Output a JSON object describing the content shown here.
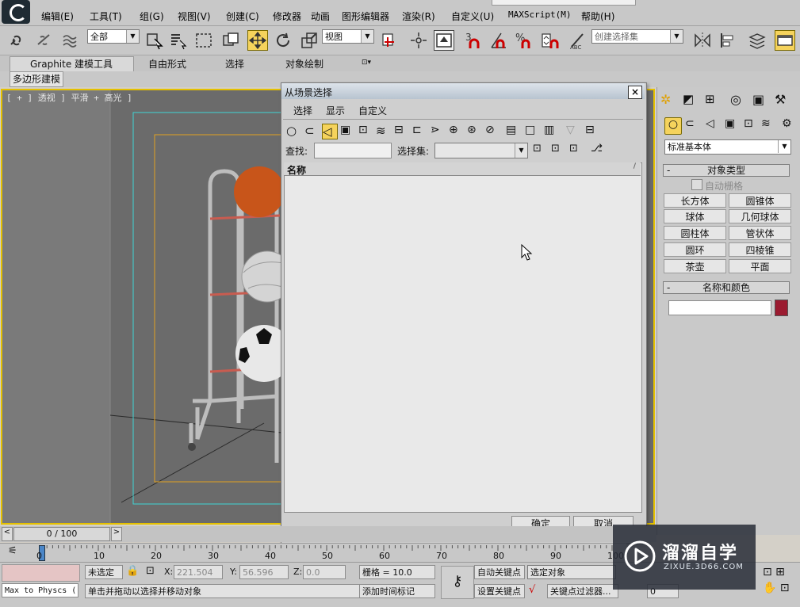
{
  "menu": {
    "items": [
      "编辑(E)",
      "工具(T)",
      "组(G)",
      "视图(V)",
      "创建(C)",
      "修改器",
      "动画",
      "图形编辑器",
      "渲染(R)",
      "自定义(U)",
      "MAXScript(M)",
      "帮助(H)"
    ]
  },
  "toolbar": {
    "filter_value": "全部",
    "refcoord_value": "视图",
    "snap_labels": [
      "3",
      "%"
    ],
    "named_selection_placeholder": "创建选择集"
  },
  "ribbon": {
    "tabs": [
      "Graphite 建模工具",
      "自由形式",
      "选择",
      "对象绘制"
    ],
    "subtab": "多边形建模"
  },
  "viewport": {
    "label": "[ + ] 透视 ] 平滑 + 高光 ]"
  },
  "dialog": {
    "title": "从场景选择",
    "close_glyph": "×",
    "menu": [
      "选择",
      "显示",
      "自定义"
    ],
    "find_label": "查找:",
    "find_value": "",
    "selset_label": "选择集:",
    "selset_value": "",
    "list_header": "名称",
    "ok_label": "确定",
    "cancel_label": "取消"
  },
  "cmdpanel": {
    "category_value": "标准基本体",
    "rollout_object_type": "对象类型",
    "autogrid_label": "自动栅格",
    "buttons": [
      "长方体",
      "圆锥体",
      "球体",
      "几何球体",
      "圆柱体",
      "管状体",
      "圆环",
      "四棱锥",
      "茶壶",
      "平面"
    ],
    "rollout_name_color": "名称和颜色",
    "name_value": "",
    "object_color": "#9b1b30"
  },
  "timeline": {
    "frame_display": "0 / 100",
    "prev_glyph": "<",
    "next_glyph": ">",
    "ticks": [
      "0",
      "10",
      "20",
      "30",
      "40",
      "50",
      "60",
      "70",
      "80",
      "90",
      "100"
    ]
  },
  "statusbar": {
    "script_field": "Max to Physcs (",
    "selection_info": "未选定",
    "x_label": "X:",
    "x_value": "221.504",
    "y_label": "Y:",
    "y_value": "56.596",
    "z_label": "Z:",
    "z_value": "0.0",
    "grid_label": "栅格 = 10.0",
    "autokey_label": "自动关键点",
    "selected_dropdown": "选定对象",
    "setkey_label": "设置关键点",
    "keyfilter_label": "关键点过滤器...",
    "prompt": "单击并拖动以选择并移动对象",
    "add_time_tag": "添加时间标记",
    "frame_field": "0"
  },
  "watermark": {
    "brand": "溜溜自学",
    "url": "ZIXUE.3D66.COM"
  },
  "colors": {
    "viewport_bg": "#7a7a7a",
    "active_border": "#e5c100",
    "ball_orange": "#c8551a"
  }
}
